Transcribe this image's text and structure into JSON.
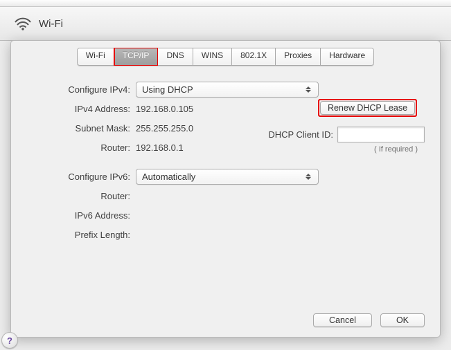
{
  "header": {
    "title": "Wi-Fi"
  },
  "tabs": [
    {
      "label": "Wi-Fi"
    },
    {
      "label": "TCP/IP"
    },
    {
      "label": "DNS"
    },
    {
      "label": "WINS"
    },
    {
      "label": "802.1X"
    },
    {
      "label": "Proxies"
    },
    {
      "label": "Hardware"
    }
  ],
  "active_tab_index": 1,
  "ipv4": {
    "configure_label": "Configure IPv4:",
    "configure_value": "Using DHCP",
    "address_label": "IPv4 Address:",
    "address_value": "192.168.0.105",
    "subnet_label": "Subnet Mask:",
    "subnet_value": "255.255.255.0",
    "router_label": "Router:",
    "router_value": "192.168.0.1"
  },
  "dhcp": {
    "renew_button": "Renew DHCP Lease",
    "client_id_label": "DHCP Client ID:",
    "client_id_value": "",
    "client_id_hint": "( If required )"
  },
  "ipv6": {
    "configure_label": "Configure IPv6:",
    "configure_value": "Automatically",
    "router_label": "Router:",
    "router_value": "",
    "address_label": "IPv6 Address:",
    "address_value": "",
    "prefix_label": "Prefix Length:",
    "prefix_value": ""
  },
  "footer": {
    "help": "?",
    "cancel": "Cancel",
    "ok": "OK"
  }
}
